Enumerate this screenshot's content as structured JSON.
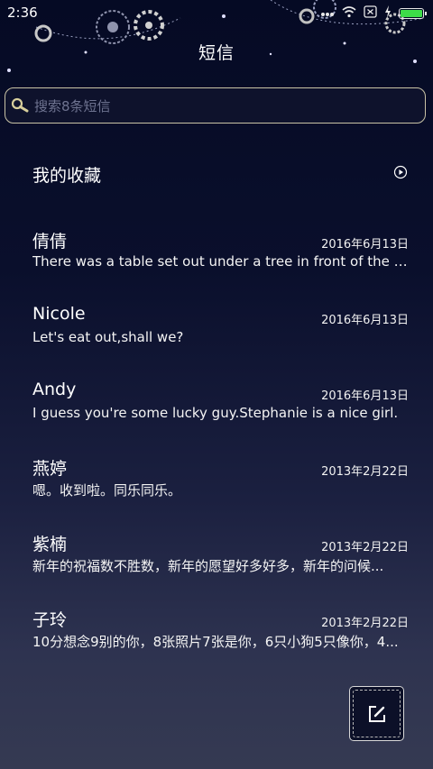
{
  "status_bar": {
    "time": "2:36",
    "icons": [
      "signal-dots-icon",
      "wifi-icon",
      "close-box-icon",
      "charging-icon",
      "battery-icon"
    ],
    "battery_color": "#3ddc48"
  },
  "header": {
    "title": "短信"
  },
  "search": {
    "placeholder": "搜索8条短信"
  },
  "favorites": {
    "label": "我的收藏"
  },
  "messages": [
    {
      "name": "倩倩",
      "date": "2016年6月13日",
      "preview": "There was a table set out under a tree in front of the ho..."
    },
    {
      "name": "Nicole",
      "date": "2016年6月13日",
      "preview": "Let's eat out,shall we?"
    },
    {
      "name": "Andy",
      "date": "2016年6月13日",
      "preview": "I guess you're some lucky guy.Stephanie is a nice girl."
    },
    {
      "name": "燕婷",
      "date": "2013年2月22日",
      "preview": "嗯。收到啦。同乐同乐。"
    },
    {
      "name": "紫楠",
      "date": "2013年2月22日",
      "preview": "新年的祝福数不胜数，新年的愿望好多好多，新年的问候..."
    },
    {
      "name": "子玲",
      "date": "2013年2月22日",
      "preview": "10分想念9别的你，8张照片7张是你，6只小狗5只像你，4..."
    }
  ],
  "compose": {
    "icon": "compose-icon"
  },
  "colors": {
    "search_border": "#c9c3a6",
    "background_top": "#050a24",
    "background_bottom": "#353a52"
  }
}
